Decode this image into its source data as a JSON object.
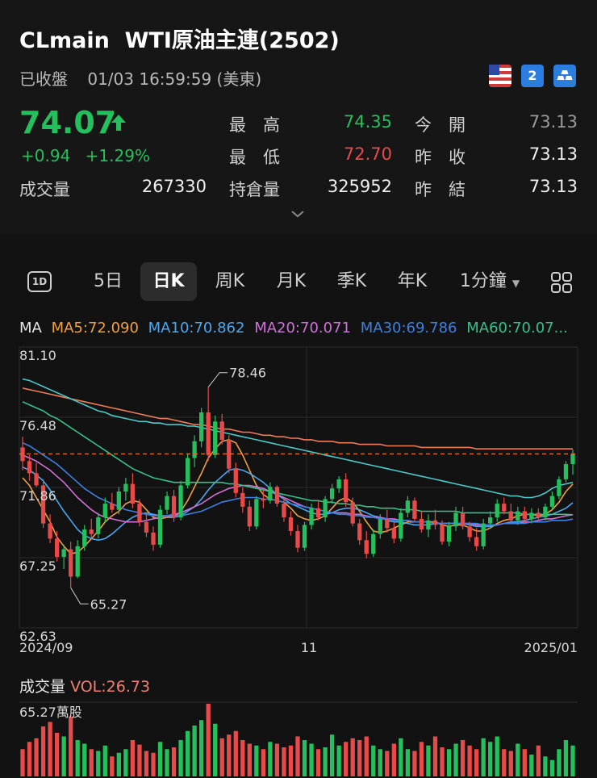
{
  "header": {
    "symbol": "CLmain",
    "name": "WTI原油主連(2502)",
    "status": "已收盤",
    "datetime": "01/03 16:59:59 (美東)",
    "badge2_label": "2",
    "price": "74.07",
    "change": "+0.94",
    "change_pct": "+1.29%"
  },
  "stats": {
    "high_label": "最　高",
    "high": "74.35",
    "low_label": "最　低",
    "low": "72.70",
    "open_label": "今　開",
    "open": "73.13",
    "prev_close_label": "昨　收",
    "prev_close": "73.13",
    "volume_label": "成交量",
    "volume": "267330",
    "oi_label": "持倉量",
    "oi": "325952",
    "prev_settle_label": "昨　結",
    "prev_settle": "73.13"
  },
  "tabs": [
    {
      "label": "5日"
    },
    {
      "label": "日K"
    },
    {
      "label": "周K"
    },
    {
      "label": "月K"
    },
    {
      "label": "季K"
    },
    {
      "label": "年K"
    },
    {
      "label": "1分鐘"
    }
  ],
  "ma": {
    "label": "MA",
    "ma5": "MA5:72.090",
    "ma10": "MA10:70.862",
    "ma20": "MA20:70.071",
    "ma30": "MA30:69.786",
    "ma60": "MA60:70.07..."
  },
  "colors": {
    "up": "#24c05d",
    "down": "#e84a4a",
    "ma5": "#f0a040",
    "ma10": "#4aa8f0",
    "ma20": "#d070d8",
    "ma30": "#3f7fe0",
    "ma60": "#36c08a"
  },
  "chart_data": {
    "type": "candlestick",
    "yticks": [
      "81.10",
      "76.48",
      "71.86",
      "67.25",
      "62.63"
    ],
    "xticks": [
      "2024/09",
      "11",
      "2025/01"
    ],
    "ylim": [
      62.63,
      81.1
    ],
    "high_annotation": "78.46",
    "low_annotation": "65.27",
    "current_price": 74.07,
    "candles": [
      [
        74.5,
        75.2,
        73.0,
        73.6
      ],
      [
        73.6,
        74.0,
        72.3,
        72.8
      ],
      [
        72.8,
        73.5,
        71.9,
        72.0
      ],
      [
        72.0,
        72.4,
        69.2,
        69.5
      ],
      [
        69.5,
        70.1,
        68.2,
        68.5
      ],
      [
        68.5,
        69.0,
        67.0,
        67.3
      ],
      [
        67.3,
        68.1,
        66.5,
        67.8
      ],
      [
        67.8,
        68.3,
        65.27,
        66.0
      ],
      [
        66.0,
        68.4,
        65.9,
        68.0
      ],
      [
        68.0,
        69.4,
        67.7,
        69.1
      ],
      [
        69.1,
        69.8,
        68.6,
        68.8
      ],
      [
        68.8,
        70.2,
        68.5,
        69.9
      ],
      [
        69.9,
        71.2,
        69.6,
        70.8
      ],
      [
        70.8,
        71.5,
        70.2,
        70.4
      ],
      [
        70.4,
        71.9,
        70.1,
        71.6
      ],
      [
        71.6,
        72.5,
        71.0,
        72.1
      ],
      [
        72.1,
        72.8,
        70.5,
        70.8
      ],
      [
        70.8,
        71.1,
        69.3,
        69.6
      ],
      [
        69.6,
        70.2,
        68.6,
        68.9
      ],
      [
        68.9,
        69.3,
        67.7,
        68.1
      ],
      [
        68.1,
        70.7,
        67.9,
        70.4
      ],
      [
        70.4,
        71.6,
        70.1,
        71.3
      ],
      [
        71.3,
        71.7,
        69.6,
        69.9
      ],
      [
        69.9,
        72.3,
        69.7,
        72.0
      ],
      [
        72.0,
        74.1,
        71.8,
        73.8
      ],
      [
        73.8,
        75.3,
        73.2,
        74.9
      ],
      [
        74.9,
        77.1,
        74.5,
        76.8
      ],
      [
        76.8,
        78.46,
        73.6,
        74.0
      ],
      [
        74.0,
        76.6,
        73.8,
        76.2
      ],
      [
        76.2,
        76.7,
        74.7,
        75.0
      ],
      [
        75.0,
        75.3,
        72.8,
        73.1
      ],
      [
        73.1,
        73.5,
        71.2,
        71.5
      ],
      [
        71.5,
        71.9,
        70.2,
        70.6
      ],
      [
        70.6,
        71.0,
        69.0,
        69.3
      ],
      [
        69.3,
        71.3,
        69.1,
        71.1
      ],
      [
        71.1,
        71.7,
        70.5,
        71.0
      ],
      [
        71.0,
        72.2,
        70.8,
        71.9
      ],
      [
        71.9,
        72.0,
        70.6,
        70.8
      ],
      [
        70.8,
        71.2,
        69.6,
        69.9
      ],
      [
        69.9,
        70.3,
        68.7,
        69.0
      ],
      [
        69.0,
        69.4,
        67.6,
        67.9
      ],
      [
        67.9,
        69.6,
        67.7,
        69.4
      ],
      [
        69.4,
        70.8,
        69.1,
        70.5
      ],
      [
        70.5,
        71.0,
        69.7,
        69.9
      ],
      [
        69.9,
        71.3,
        69.6,
        71.1
      ],
      [
        71.1,
        72.1,
        70.8,
        71.8
      ],
      [
        71.8,
        72.6,
        71.5,
        72.4
      ],
      [
        72.4,
        72.8,
        70.6,
        70.9
      ],
      [
        70.9,
        71.2,
        69.3,
        69.5
      ],
      [
        69.5,
        69.8,
        68.1,
        68.4
      ],
      [
        68.4,
        69.0,
        67.2,
        67.5
      ],
      [
        67.5,
        69.1,
        67.3,
        68.8
      ],
      [
        68.8,
        70.1,
        68.5,
        69.8
      ],
      [
        69.8,
        70.4,
        68.9,
        69.2
      ],
      [
        69.2,
        69.6,
        68.2,
        68.5
      ],
      [
        68.5,
        70.5,
        68.3,
        70.2
      ],
      [
        70.2,
        71.3,
        69.9,
        71.0
      ],
      [
        71.0,
        71.2,
        69.6,
        69.8
      ],
      [
        69.8,
        70.3,
        68.9,
        69.1
      ],
      [
        69.1,
        70.1,
        68.6,
        69.7
      ],
      [
        69.7,
        70.4,
        69.1,
        69.4
      ],
      [
        69.4,
        69.7,
        68.1,
        68.3
      ],
      [
        68.3,
        69.6,
        68.0,
        69.3
      ],
      [
        69.3,
        70.6,
        69.0,
        70.2
      ],
      [
        70.2,
        70.6,
        69.1,
        69.3
      ],
      [
        69.3,
        69.6,
        68.3,
        68.6
      ],
      [
        68.6,
        69.2,
        67.7,
        68.0
      ],
      [
        68.0,
        69.8,
        67.8,
        69.5
      ],
      [
        69.5,
        70.3,
        69.2,
        69.9
      ],
      [
        69.9,
        71.1,
        69.6,
        70.8
      ],
      [
        70.8,
        71.2,
        70.1,
        70.3
      ],
      [
        70.3,
        70.8,
        69.5,
        69.7
      ],
      [
        69.7,
        70.6,
        69.4,
        70.3
      ],
      [
        70.3,
        70.6,
        69.6,
        69.8
      ],
      [
        69.8,
        70.5,
        69.5,
        70.2
      ],
      [
        70.2,
        70.5,
        69.6,
        69.9
      ],
      [
        69.9,
        70.8,
        69.7,
        70.6
      ],
      [
        70.6,
        71.6,
        70.4,
        71.3
      ],
      [
        71.3,
        72.6,
        71.1,
        72.4
      ],
      [
        72.4,
        73.6,
        72.2,
        73.4
      ],
      [
        73.4,
        74.35,
        72.7,
        74.07
      ]
    ],
    "ma_lines": {
      "ma5": [
        72.5,
        72.0,
        71.2,
        70.4,
        69.6,
        68.6,
        68.0,
        67.5,
        67.6,
        68.0,
        68.5,
        69.0,
        69.6,
        70.0,
        70.3,
        70.8,
        71.0,
        70.9,
        70.4,
        69.9,
        69.8,
        69.9,
        69.9,
        70.3,
        71.0,
        71.9,
        72.8,
        73.8,
        74.4,
        74.9,
        75.0,
        74.8,
        74.0,
        73.0,
        72.0,
        71.4,
        71.1,
        71.0,
        70.9,
        70.5,
        70.0,
        69.8,
        69.7,
        69.8,
        70.0,
        70.5,
        71.0,
        71.2,
        70.9,
        70.3,
        69.6,
        69.0,
        68.9,
        69.0,
        69.2,
        69.4,
        69.6,
        69.6,
        69.6,
        69.6,
        69.6,
        69.4,
        69.3,
        69.4,
        69.4,
        69.2,
        69.0,
        69.0,
        69.2,
        69.5,
        69.7,
        69.8,
        70.0,
        70.1,
        70.1,
        70.0,
        70.1,
        70.4,
        70.9,
        71.6,
        72.09
      ],
      "ma10": [
        73.2,
        73.0,
        72.7,
        72.3,
        71.7,
        71.0,
        70.3,
        69.7,
        69.1,
        68.7,
        68.5,
        68.4,
        68.5,
        68.8,
        69.2,
        69.6,
        69.9,
        70.1,
        70.2,
        70.1,
        70.0,
        70.0,
        69.9,
        70.0,
        70.3,
        70.6,
        71.1,
        71.7,
        72.2,
        72.6,
        73.0,
        73.1,
        73.0,
        72.8,
        72.5,
        72.2,
        71.8,
        71.4,
        71.1,
        70.8,
        70.6,
        70.4,
        70.2,
        70.1,
        70.1,
        70.2,
        70.4,
        70.5,
        70.5,
        70.4,
        70.2,
        70.0,
        69.9,
        69.7,
        69.6,
        69.6,
        69.5,
        69.4,
        69.4,
        69.4,
        69.5,
        69.5,
        69.5,
        69.5,
        69.5,
        69.4,
        69.3,
        69.3,
        69.3,
        69.4,
        69.5,
        69.6,
        69.6,
        69.7,
        69.8,
        69.9,
        70.0,
        70.1,
        70.3,
        70.5,
        70.862
      ],
      "ma20": [
        74.0,
        73.8,
        73.6,
        73.3,
        73.0,
        72.6,
        72.2,
        71.7,
        71.2,
        70.8,
        70.4,
        70.1,
        69.9,
        69.8,
        69.7,
        69.6,
        69.6,
        69.6,
        69.7,
        69.8,
        69.9,
        70.0,
        70.1,
        70.2,
        70.4,
        70.6,
        70.8,
        71.1,
        71.4,
        71.6,
        71.8,
        71.9,
        72.0,
        72.0,
        71.9,
        71.8,
        71.6,
        71.4,
        71.2,
        71.0,
        70.8,
        70.6,
        70.5,
        70.4,
        70.3,
        70.2,
        70.2,
        70.2,
        70.1,
        70.1,
        70.0,
        69.9,
        69.9,
        69.8,
        69.8,
        69.7,
        69.7,
        69.6,
        69.6,
        69.6,
        69.5,
        69.5,
        69.5,
        69.5,
        69.5,
        69.5,
        69.4,
        69.4,
        69.4,
        69.4,
        69.5,
        69.5,
        69.5,
        69.6,
        69.6,
        69.7,
        69.8,
        69.8,
        69.9,
        70.0,
        70.071
      ],
      "ma30": [
        74.8,
        74.6,
        74.3,
        74.0,
        73.7,
        73.4,
        73.0,
        72.6,
        72.2,
        71.8,
        71.5,
        71.2,
        71.0,
        70.8,
        70.6,
        70.4,
        70.3,
        70.2,
        70.1,
        70.0,
        70.0,
        70.0,
        70.0,
        70.0,
        70.1,
        70.2,
        70.3,
        70.5,
        70.7,
        70.9,
        71.0,
        71.1,
        71.2,
        71.2,
        71.2,
        71.1,
        71.1,
        71.0,
        70.9,
        70.8,
        70.7,
        70.6,
        70.5,
        70.4,
        70.3,
        70.2,
        70.1,
        70.1,
        70.0,
        70.0,
        69.9,
        69.9,
        69.8,
        69.8,
        69.7,
        69.7,
        69.7,
        69.6,
        69.6,
        69.6,
        69.5,
        69.5,
        69.5,
        69.5,
        69.5,
        69.5,
        69.5,
        69.4,
        69.4,
        69.4,
        69.5,
        69.5,
        69.5,
        69.5,
        69.6,
        69.6,
        69.6,
        69.7,
        69.7,
        69.7,
        69.786
      ],
      "ma60": [
        77.5,
        77.3,
        77.1,
        76.9,
        76.6,
        76.4,
        76.1,
        75.8,
        75.5,
        75.2,
        74.9,
        74.6,
        74.3,
        74.0,
        73.7,
        73.4,
        73.1,
        72.9,
        72.7,
        72.5,
        72.4,
        72.3,
        72.2,
        72.2,
        72.2,
        72.2,
        72.2,
        72.2,
        72.2,
        72.2,
        72.1,
        72.1,
        72.0,
        71.9,
        71.8,
        71.7,
        71.6,
        71.5,
        71.4,
        71.3,
        71.2,
        71.1,
        71.0,
        71.0,
        70.9,
        70.9,
        70.8,
        70.8,
        70.7,
        70.7,
        70.6,
        70.6,
        70.5,
        70.5,
        70.5,
        70.4,
        70.4,
        70.4,
        70.3,
        70.3,
        70.3,
        70.3,
        70.3,
        70.3,
        70.2,
        70.2,
        70.2,
        70.2,
        70.2,
        70.2,
        70.2,
        70.2,
        70.2,
        70.1,
        70.1,
        70.1,
        70.1,
        70.1,
        70.1,
        70.1,
        70.07
      ],
      "ma120": [
        78.4,
        78.3,
        78.2,
        78.1,
        78.0,
        77.9,
        77.8,
        77.7,
        77.6,
        77.5,
        77.4,
        77.3,
        77.2,
        77.1,
        77.0,
        76.9,
        76.8,
        76.7,
        76.6,
        76.5,
        76.4,
        76.4,
        76.3,
        76.2,
        76.1,
        76.0,
        76.0,
        75.9,
        75.8,
        75.7,
        75.7,
        75.6,
        75.5,
        75.5,
        75.4,
        75.3,
        75.3,
        75.2,
        75.2,
        75.1,
        75.1,
        75.0,
        75.0,
        74.9,
        74.9,
        74.9,
        74.8,
        74.8,
        74.8,
        74.7,
        74.7,
        74.7,
        74.7,
        74.6,
        74.6,
        74.6,
        74.6,
        74.6,
        74.5,
        74.5,
        74.5,
        74.5,
        74.5,
        74.5,
        74.5,
        74.5,
        74.4,
        74.4,
        74.4,
        74.4,
        74.4,
        74.4,
        74.4,
        74.4,
        74.4,
        74.4,
        74.4,
        74.4,
        74.4,
        74.4,
        74.4
      ],
      "ma250": [
        79.0,
        78.9,
        78.7,
        78.5,
        78.3,
        78.1,
        77.9,
        77.7,
        77.5,
        77.3,
        77.1,
        76.9,
        76.8,
        76.6,
        76.5,
        76.4,
        76.3,
        76.2,
        76.2,
        76.1,
        76.1,
        76.0,
        76.0,
        76.0,
        75.9,
        75.9,
        75.8,
        75.7,
        75.6,
        75.5,
        75.4,
        75.3,
        75.2,
        75.1,
        75.0,
        74.9,
        74.8,
        74.7,
        74.6,
        74.5,
        74.4,
        74.3,
        74.2,
        74.1,
        74.0,
        73.9,
        73.8,
        73.7,
        73.6,
        73.5,
        73.4,
        73.3,
        73.2,
        73.1,
        73.0,
        72.9,
        72.8,
        72.7,
        72.6,
        72.5,
        72.4,
        72.3,
        72.2,
        72.1,
        72.0,
        71.9,
        71.8,
        71.7,
        71.6,
        71.5,
        71.4,
        71.3,
        71.3,
        71.2,
        71.2,
        71.3,
        71.5,
        71.8,
        72.0,
        72.1,
        72.2
      ]
    }
  },
  "volume": {
    "label": "成交量",
    "vol_text": "VOL:26.73",
    "max_label": "65.27萬股",
    "values": [
      30,
      38,
      42,
      55,
      60,
      48,
      44,
      66,
      40,
      36,
      30,
      28,
      34,
      22,
      26,
      30,
      40,
      35,
      28,
      26,
      38,
      30,
      32,
      40,
      50,
      56,
      62,
      80,
      58,
      42,
      46,
      50,
      40,
      36,
      34,
      30,
      38,
      36,
      32,
      34,
      44,
      40,
      36,
      30,
      32,
      46,
      34,
      38,
      42,
      40,
      44,
      34,
      30,
      28,
      36,
      42,
      30,
      28,
      38,
      34,
      44,
      32,
      30,
      36,
      40,
      34,
      30,
      42,
      38,
      44,
      30,
      28,
      36,
      30,
      24,
      34,
      22,
      18,
      30,
      40,
      34
    ]
  }
}
